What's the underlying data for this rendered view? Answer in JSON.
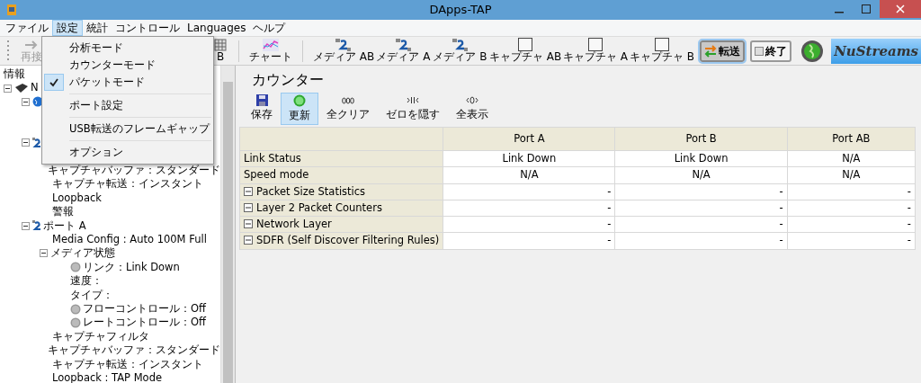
{
  "window": {
    "title": "DApps-TAP"
  },
  "menu_bar": [
    {
      "label": "ファイル",
      "selected": false
    },
    {
      "label": "設定",
      "selected": true
    },
    {
      "label": "統計",
      "selected": false
    },
    {
      "label": "コントロール",
      "selected": false
    },
    {
      "label": "Languages",
      "selected": false
    },
    {
      "label": "ヘルプ",
      "selected": false
    }
  ],
  "open_menu": [
    {
      "kind": "item",
      "label": "分析モード",
      "checked": false
    },
    {
      "kind": "item",
      "label": "カウンターモード",
      "checked": false
    },
    {
      "kind": "item",
      "label": "パケットモード",
      "checked": true
    },
    {
      "kind": "separator"
    },
    {
      "kind": "item",
      "label": "ポート設定",
      "checked": false
    },
    {
      "kind": "separator"
    },
    {
      "kind": "item",
      "label": "USB転送のフレームギャップ",
      "checked": false
    },
    {
      "kind": "separator"
    },
    {
      "kind": "item",
      "label": "オプション",
      "checked": false
    }
  ],
  "toolbar": [
    {
      "kind": "reconnect",
      "label": "再接",
      "disabled": true
    },
    {
      "kind": "grid",
      "label": "B",
      "disabled": false
    },
    {
      "kind": "chart",
      "label": "チャート",
      "disabled": false
    },
    {
      "kind": "media",
      "label": "メディア AB",
      "disabled": false
    },
    {
      "kind": "media",
      "label": "メディア A",
      "disabled": false
    },
    {
      "kind": "media",
      "label": "メディア B",
      "disabled": false
    },
    {
      "kind": "capture",
      "label": "キャプチャ AB",
      "disabled": false
    },
    {
      "kind": "capture",
      "label": "キャプチャ A",
      "disabled": false
    },
    {
      "kind": "capture",
      "label": "キャプチャ B",
      "disabled": false
    }
  ],
  "mode_buttons": [
    {
      "kind": "transfer",
      "label": "転送",
      "selected": true
    },
    {
      "kind": "stop",
      "label": "終了",
      "selected": false
    }
  ],
  "logo": {
    "text": "NuStreams"
  },
  "tree": {
    "header": "情報",
    "items": [
      {
        "kind": "device",
        "label": "N",
        "expanded": true,
        "children": [
          {
            "kind": "globe",
            "expanded": true
          },
          {
            "kind": "port",
            "expanded": true,
            "children": [
              {
                "label": "キャプチャバッファ：スタンダード"
              },
              {
                "label": "キャプチャ転送：インスタント"
              },
              {
                "label": "Loopback"
              },
              {
                "label": "警報"
              }
            ]
          },
          {
            "kind": "port",
            "label": "ポート A",
            "expanded": true,
            "children": [
              {
                "label": "Media Config : Auto 100M Full"
              },
              {
                "label": "メディア状態",
                "expanded": true,
                "children": [
                  {
                    "kind": "led",
                    "label": "リンク：Link Down"
                  },
                  {
                    "label": "速度："
                  },
                  {
                    "label": "タイプ："
                  },
                  {
                    "kind": "led",
                    "label": "フローコントロール：Off"
                  },
                  {
                    "kind": "led",
                    "label": "レートコントロール：Off"
                  }
                ]
              },
              {
                "label": "キャプチャフィルタ"
              },
              {
                "label": "キャプチャバッファ：スタンダード"
              },
              {
                "label": "キャプチャ転送：インスタント"
              },
              {
                "label": "Loopback : TAP Mode"
              }
            ]
          }
        ]
      }
    ]
  },
  "counter": {
    "title": "カウンター",
    "actions": [
      {
        "kind": "save",
        "label": "保存",
        "selected": false
      },
      {
        "kind": "refresh",
        "label": "更新",
        "selected": true
      },
      {
        "kind": "zeros",
        "label": "全クリア",
        "selected": false
      },
      {
        "kind": "hide",
        "label": "ゼロを隠す",
        "selected": false
      },
      {
        "kind": "show",
        "label": "全表示",
        "selected": false
      }
    ],
    "table": {
      "columns": [
        "Port A",
        "Port B",
        "Port AB"
      ],
      "rows": [
        {
          "label": "Link Status",
          "group": false,
          "cells": [
            "Link Down",
            "Link Down",
            "N/A"
          ]
        },
        {
          "label": "Speed mode",
          "group": false,
          "cells": [
            "N/A",
            "N/A",
            "N/A"
          ]
        },
        {
          "label": "Packet Size Statistics",
          "group": true,
          "cells": [
            "-",
            "-",
            "-"
          ]
        },
        {
          "label": "Layer 2 Packet Counters",
          "group": true,
          "cells": [
            "-",
            "-",
            "-"
          ]
        },
        {
          "label": "Network Layer",
          "group": true,
          "cells": [
            "-",
            "-",
            "-"
          ]
        },
        {
          "label": "SDFR (Self Discover Filtering Rules)",
          "group": true,
          "cells": [
            "-",
            "-",
            "-"
          ]
        }
      ]
    }
  }
}
